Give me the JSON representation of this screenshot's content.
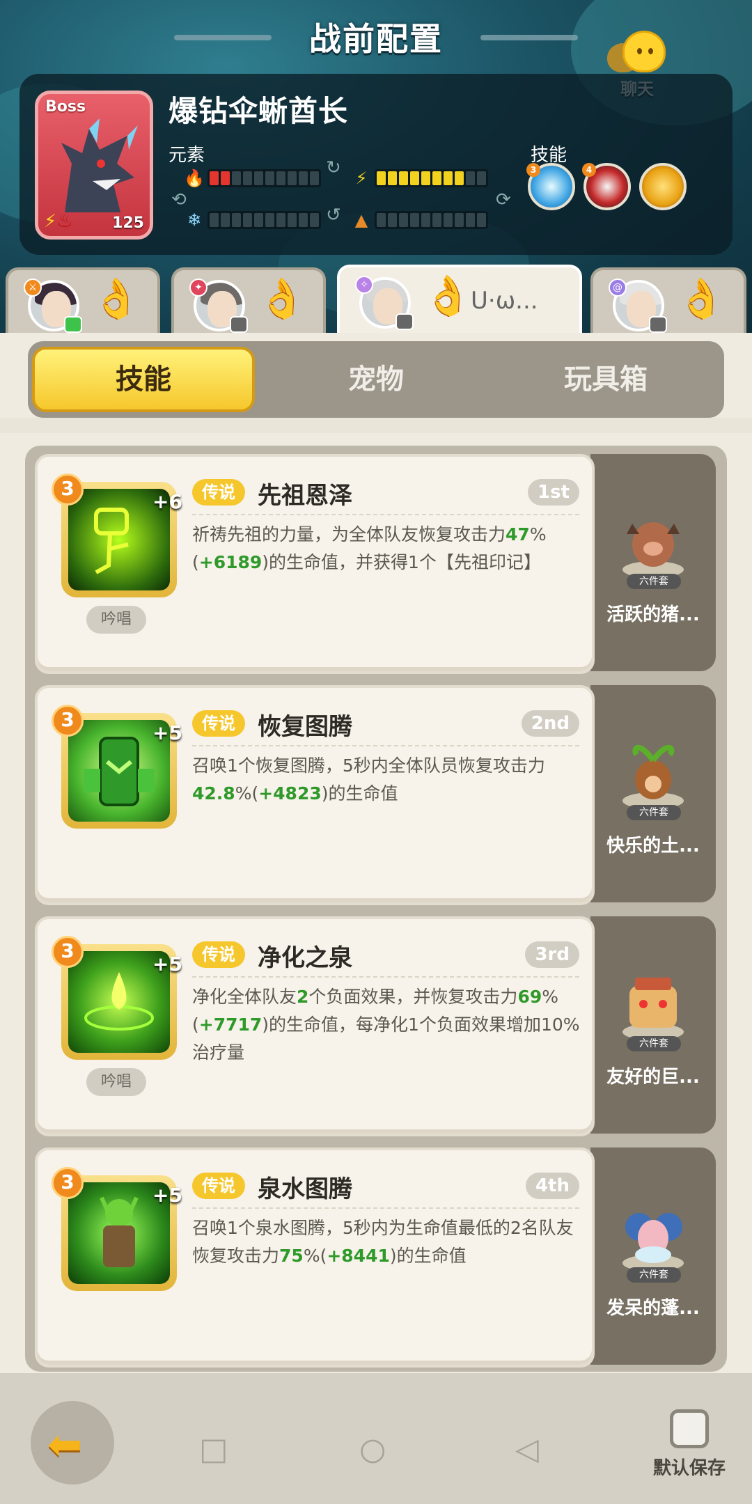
{
  "header": {
    "title": "战前配置",
    "chat_label": "聊天"
  },
  "boss": {
    "tag": "Boss",
    "name": "爆钻伞蜥酋长",
    "level": "125",
    "element_label": "元素",
    "skill_label": "技能",
    "elements": [
      {
        "name": "fire",
        "icon": "fire-icon",
        "filled": 2,
        "total": 10,
        "color": "#e2362f"
      },
      {
        "name": "lightning",
        "icon": "lightning-icon",
        "filled": 8,
        "total": 10,
        "color": "#f3d21f"
      },
      {
        "name": "ice",
        "icon": "snowflake-icon",
        "filled": 0,
        "total": 10,
        "color": "#4fb6e8"
      },
      {
        "name": "earth",
        "icon": "mountain-icon",
        "filled": 0,
        "total": 10,
        "color": "#e98a2a"
      }
    ],
    "skills": [
      {
        "icon": "ice-burst-icon",
        "level": "3"
      },
      {
        "icon": "beast-bite-icon",
        "level": "4"
      },
      {
        "icon": "crown-icon",
        "level": ""
      }
    ]
  },
  "players": [
    {
      "name": "",
      "badge": "sword",
      "active": false
    },
    {
      "name": "",
      "badge": "flame",
      "active": false
    },
    {
      "name": "U·ω...",
      "badge": "star",
      "active": true
    },
    {
      "name": "",
      "badge": "swirl",
      "active": false
    }
  ],
  "categories": {
    "skills": "技能",
    "pets": "宠物",
    "toybox": "玩具箱",
    "active": "skills"
  },
  "skills": [
    {
      "level": "3",
      "plus": "+6",
      "rarity": "传说",
      "name": "先祖恩泽",
      "rank": "1st",
      "chant": "吟唱",
      "desc_parts": [
        "祈祷先祖的力量，为全体队友恢复攻击力",
        "47",
        "%(",
        "+6189",
        ")的生命值，并获得1个【先祖印记】"
      ],
      "pet": {
        "tag": "六件套",
        "name": "活跃的猪..."
      }
    },
    {
      "level": "3",
      "plus": "+5",
      "rarity": "传说",
      "name": "恢复图腾",
      "rank": "2nd",
      "chant": "",
      "desc_parts": [
        "召唤1个恢复图腾，5秒内全体队员恢复攻击力",
        "42.8",
        "%(",
        "+4823",
        ")的生命值"
      ],
      "pet": {
        "tag": "六件套",
        "name": "快乐的土..."
      }
    },
    {
      "level": "3",
      "plus": "+5",
      "rarity": "传说",
      "name": "净化之泉",
      "rank": "3rd",
      "chant": "吟唱",
      "desc_parts": [
        "净化全体队友",
        "2",
        "个负面效果，并恢复攻击力",
        "69",
        "%(",
        "+7717",
        ")的生命值，每净化1个负面效果增加10%治疗量"
      ],
      "pet": {
        "tag": "六件套",
        "name": "友好的巨..."
      }
    },
    {
      "level": "3",
      "plus": "+5",
      "rarity": "传说",
      "name": "泉水图腾",
      "rank": "4th",
      "chant": "",
      "desc_parts": [
        "召唤1个泉水图腾，5秒内为生命值最低的2名队友恢复攻击力",
        "75",
        "%(",
        "+8441",
        ")的生命值"
      ],
      "pet": {
        "tag": "六件套",
        "name": "发呆的蓬..."
      }
    }
  ],
  "footer": {
    "default_save": "默认保存"
  }
}
